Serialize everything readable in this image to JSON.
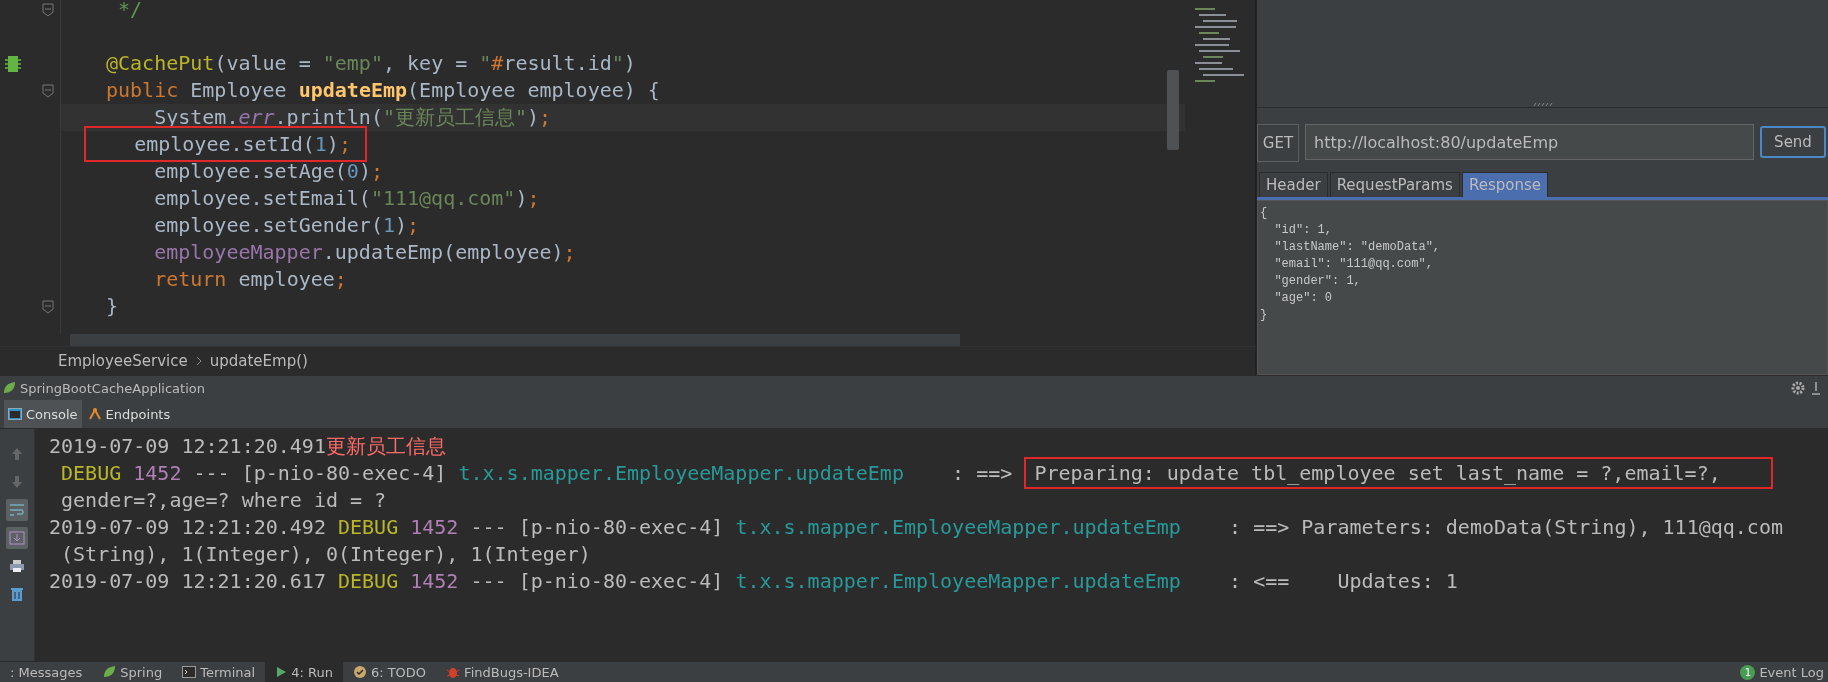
{
  "editor": {
    "code_lines": [
      {
        "kind": "fold",
        "tokens": [
          {
            "kind": "comment",
            "text": " */"
          }
        ]
      },
      {
        "kind": "bean",
        "gap_before": true,
        "tokens": [
          {
            "kind": "annotation",
            "text": "@CachePut"
          },
          {
            "kind": "plain",
            "text": "(value = "
          },
          {
            "kind": "string",
            "text": "\"emp\""
          },
          {
            "kind": "plain",
            "text": ", key = "
          },
          {
            "kind": "string",
            "text": "\""
          },
          {
            "kind": "keyword",
            "text": "#"
          },
          {
            "kind": "plain",
            "text": "result.id"
          },
          {
            "kind": "string",
            "text": "\""
          },
          {
            "kind": "plain",
            "text": ")"
          }
        ]
      },
      {
        "kind": "fold",
        "tokens": [
          {
            "kind": "keyword",
            "text": "public"
          },
          {
            "kind": "plain",
            "text": " Employee "
          },
          {
            "kind": "method",
            "text": "updateEmp"
          },
          {
            "kind": "plain",
            "text": "(Employee employee) {"
          }
        ]
      },
      {
        "current": true,
        "tokens": [
          {
            "kind": "plain",
            "text": "    System."
          },
          {
            "kind": "static",
            "text": "err"
          },
          {
            "kind": "plain",
            "text": ".println("
          },
          {
            "kind": "string",
            "text": "\"更新员工信息\""
          },
          {
            "kind": "plain",
            "text": ")"
          },
          {
            "kind": "keyword",
            "text": ";"
          }
        ]
      },
      {
        "tokens": [
          {
            "kind": "plain",
            "text": "    employee.setId(",
            "boxed": true
          },
          {
            "kind": "number",
            "text": "1",
            "boxed": true
          },
          {
            "kind": "plain",
            "text": ")",
            "boxed": true
          },
          {
            "kind": "keyword",
            "text": ";",
            "boxed": true
          }
        ]
      },
      {
        "tokens": [
          {
            "kind": "plain",
            "text": "    employee.setAge("
          },
          {
            "kind": "number",
            "text": "0"
          },
          {
            "kind": "plain",
            "text": ")"
          },
          {
            "kind": "keyword",
            "text": ";"
          }
        ]
      },
      {
        "tokens": [
          {
            "kind": "plain",
            "text": "    employee.setEmail("
          },
          {
            "kind": "string",
            "text": "\"111@qq.com\""
          },
          {
            "kind": "plain",
            "text": ")"
          },
          {
            "kind": "keyword",
            "text": ";"
          }
        ]
      },
      {
        "tokens": [
          {
            "kind": "plain",
            "text": "    employee.setGender("
          },
          {
            "kind": "number",
            "text": "1"
          },
          {
            "kind": "plain",
            "text": ")"
          },
          {
            "kind": "keyword",
            "text": ";"
          }
        ]
      },
      {
        "tokens": [
          {
            "kind": "field",
            "text": "    employeeMapper"
          },
          {
            "kind": "plain",
            "text": ".updateEmp(employee)"
          },
          {
            "kind": "keyword",
            "text": ";"
          }
        ]
      },
      {
        "tokens": [
          {
            "kind": "keyword",
            "text": "    return"
          },
          {
            "kind": "plain",
            "text": " employee"
          },
          {
            "kind": "keyword",
            "text": ";"
          }
        ]
      },
      {
        "kind": "fold",
        "tokens": [
          {
            "kind": "plain",
            "text": "}"
          }
        ]
      }
    ],
    "breadcrumb": [
      "EmployeeService",
      "updateEmp()"
    ]
  },
  "http_client": {
    "method": "GET",
    "url": "http://localhost:80/updateEmp",
    "send": "Send",
    "tabs": [
      {
        "label": "Header",
        "selected": false
      },
      {
        "label": "RequestParams",
        "selected": false
      },
      {
        "label": "Response",
        "selected": true
      }
    ],
    "response_lines": [
      "{",
      "  \"id\": 1,",
      "  \"lastName\": \"demoData\",",
      "  \"email\": \"111@qq.com\",",
      "  \"gender\": 1,",
      "  \"age\": 0",
      "}"
    ]
  },
  "run_panel": {
    "title": "SpringBootCacheApplication",
    "tabs": [
      {
        "label": "Console",
        "selected": true
      },
      {
        "label": "Endpoints",
        "selected": false
      }
    ],
    "log_lines": [
      {
        "segments": [
          {
            "kind": "plain",
            "text": "2019-07-09 12:21:20.491"
          },
          {
            "kind": "stderr",
            "text": "更新员工信息"
          }
        ]
      },
      {
        "segments": [
          {
            "kind": "level",
            "text": " DEBUG"
          },
          {
            "kind": "pid",
            "text": " 1452"
          },
          {
            "kind": "plain",
            "text": " --- [p-nio-80-exec-4] "
          },
          {
            "kind": "logger",
            "text": "t.x.s.mapper.EmployeeMapper.updateEmp"
          },
          {
            "kind": "plain",
            "text": "    : ==> "
          },
          {
            "kind": "plain",
            "text": "Preparing: update tbl_employee set last_name = ?,email=?,",
            "boxed": true
          }
        ]
      },
      {
        "segments": [
          {
            "kind": "plain",
            "text": " gender=?,age=? where id = ?"
          }
        ]
      },
      {
        "segments": [
          {
            "kind": "plain",
            "text": "2019-07-09 12:21:20.492 "
          },
          {
            "kind": "level",
            "text": "DEBUG"
          },
          {
            "kind": "pid",
            "text": " 1452"
          },
          {
            "kind": "plain",
            "text": " --- [p-nio-80-exec-4] "
          },
          {
            "kind": "logger",
            "text": "t.x.s.mapper.EmployeeMapper.updateEmp"
          },
          {
            "kind": "plain",
            "text": "    : ==> Parameters: demoData(String), 111@qq.com"
          }
        ]
      },
      {
        "segments": [
          {
            "kind": "plain",
            "text": " (String), 1(Integer), 0(Integer), 1(Integer)"
          }
        ]
      },
      {
        "segments": [
          {
            "kind": "plain",
            "text": "2019-07-09 12:21:20.617 "
          },
          {
            "kind": "level",
            "text": "DEBUG"
          },
          {
            "kind": "pid",
            "text": " 1452"
          },
          {
            "kind": "plain",
            "text": " --- [p-nio-80-exec-4] "
          },
          {
            "kind": "logger",
            "text": "t.x.s.mapper.EmployeeMapper.updateEmp"
          },
          {
            "kind": "plain",
            "text": "    : <==    Updates: 1"
          }
        ]
      }
    ]
  },
  "tool_windows": [
    {
      "kind": "messages",
      "label": ": Messages",
      "selected": false
    },
    {
      "kind": "spring",
      "label": "Spring",
      "selected": false
    },
    {
      "kind": "terminal",
      "label": "Terminal",
      "selected": false
    },
    {
      "kind": "run",
      "label": "4: Run",
      "selected": true
    },
    {
      "kind": "todo",
      "label": "6: TODO",
      "selected": false
    },
    {
      "kind": "bug",
      "label": "FindBugs-IDEA",
      "selected": false
    }
  ],
  "event_log": {
    "badge": "1",
    "label": "Event Log"
  }
}
